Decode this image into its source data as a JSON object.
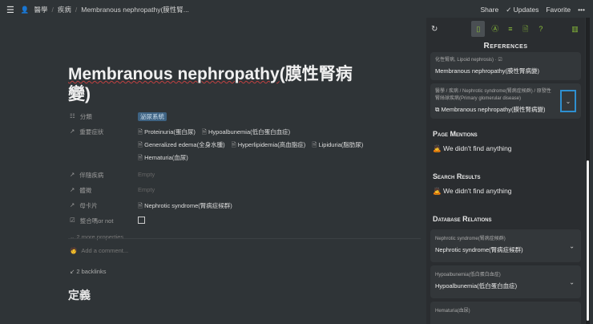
{
  "topbar": {
    "crumbs": [
      "醫學",
      "疾病",
      "Membranous nephropathy(膜性腎..."
    ],
    "share": "Share",
    "updates": "Updates",
    "favorite": "Favorite",
    "more": "•••"
  },
  "title": {
    "en": "Membranous nephropathy",
    "zh": "(膜性腎病變)"
  },
  "properties": [
    {
      "name": "分類",
      "icon": "list-icon",
      "tag": "泌尿系統"
    },
    {
      "name": "重要症狀",
      "icon": "relation-arrow-icon",
      "values": [
        "Proteinuria(蛋白尿)",
        "Hypoalbunemia(低白蛋白血症)",
        "Generalized edema(全身水腫)",
        "Hyperlipidemia(高血脂症)",
        "Lipiduria(脂肪尿)",
        "Hematuria(血尿)"
      ]
    },
    {
      "name": "伴隨疾病",
      "icon": "relation-arrow-icon",
      "empty": "Empty"
    },
    {
      "name": "體徵",
      "icon": "relation-arrow-icon",
      "empty": "Empty"
    },
    {
      "name": "母卡片",
      "icon": "relation-arrow-icon",
      "values": [
        "Nephrotic syndrome(腎病症候群)"
      ]
    },
    {
      "name": "整合嗎or not",
      "icon": "checkbox-icon"
    }
  ],
  "more_properties": "2 more properties",
  "comment_placeholder": "Add a comment...",
  "backlinks": "2 backlinks",
  "heading": "定義",
  "panel": {
    "references_title": "References",
    "ref1": {
      "path": "化性腎病, Lipoid nephrosis) · ☑",
      "link": "Membranous nephropathy(膜性腎病變)"
    },
    "ref2": {
      "path": "醫學 / 疾病 / Nephrotic syndrome(腎病症候群) / 原發性腎絲球疾病(Primary glomerular disease)",
      "link": "Membranous nephropathy(膜性腎病變)"
    },
    "page_mentions": "Page Mentions",
    "page_mentions_empty": "🙇 We didn't find anything",
    "search_results": "Search Results",
    "search_results_empty": "🙇 We didn't find anything",
    "db_relations": "Database Relations",
    "relations": [
      {
        "label": "Nephrotic syndrome(腎病症候群)",
        "value": "Nephrotic syndrome(腎病症候群)"
      },
      {
        "label": "Hypoalbunemia(低白蛋白血症)",
        "value": "Hypoalbunemia(低白蛋白血症)"
      },
      {
        "label": "Hematuria(血尿)"
      }
    ]
  }
}
